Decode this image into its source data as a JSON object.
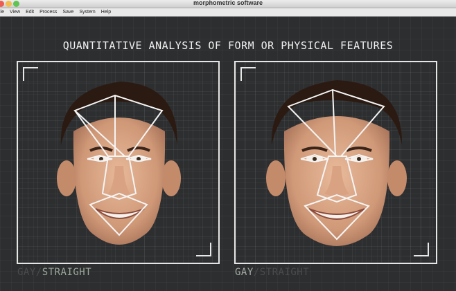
{
  "window": {
    "title": "morphometric software"
  },
  "menu": {
    "items": [
      "ile",
      "View",
      "Edit",
      "Process",
      "Save",
      "System",
      "Help"
    ]
  },
  "heading": "Quantitative analysis of form or physical features",
  "panels": {
    "left": {
      "label_dim": "GAY",
      "label_sep": "/",
      "label_bright": "STRAIGHT"
    },
    "right": {
      "label_bright": "GAY",
      "label_sep": "/",
      "label_dim": "STRAIGHT"
    }
  },
  "colors": {
    "overlay_lines": "#f5f5f5",
    "background": "#2d2e30",
    "frame": "#e6e6e6"
  }
}
